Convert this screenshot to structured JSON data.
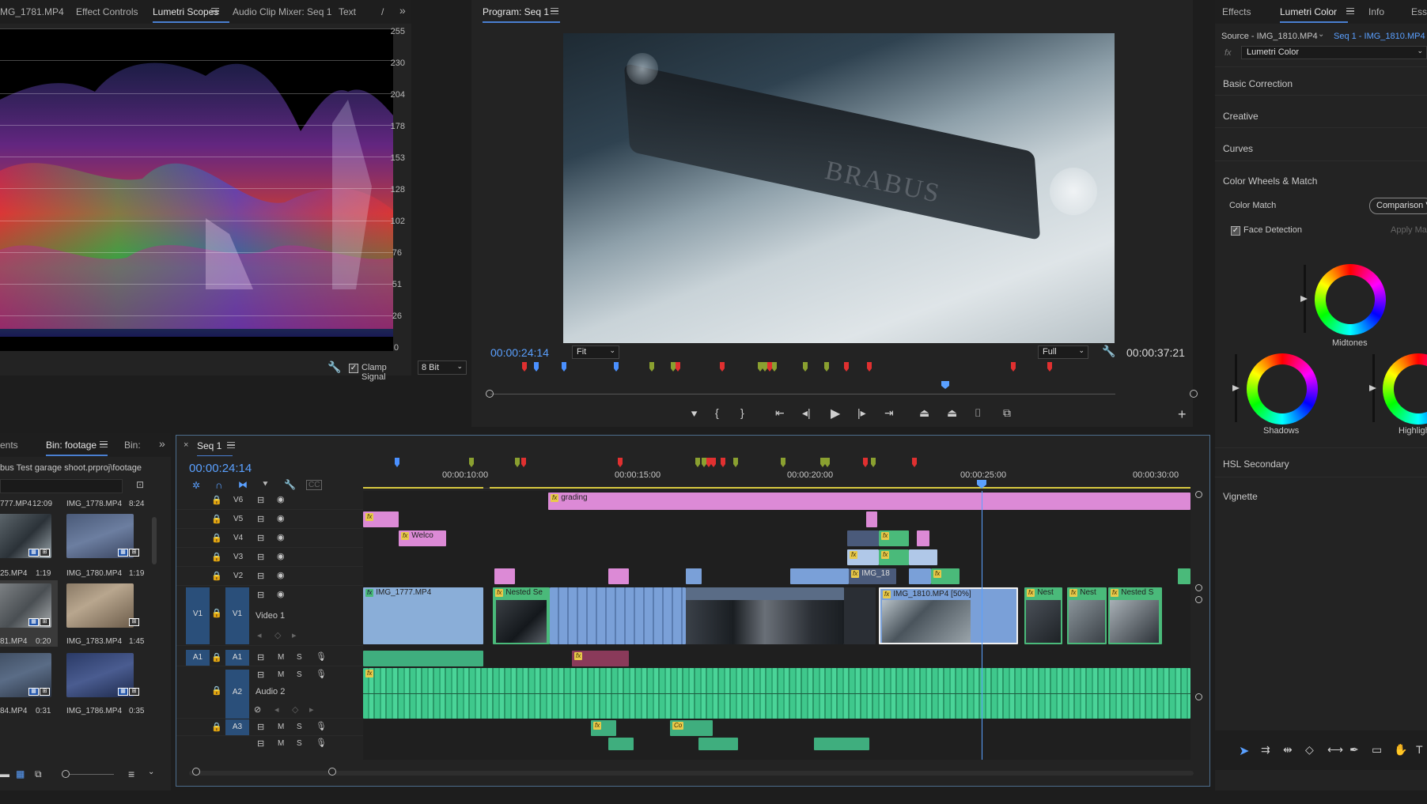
{
  "scopes": {
    "tabs": [
      "MG_1781.MP4",
      "Effect Controls",
      "Lumetri Scopes",
      "Audio Clip Mixer: Seq 1",
      "Text"
    ],
    "scale": [
      "255",
      "230",
      "204",
      "178",
      "153",
      "128",
      "102",
      "76",
      "51",
      "26",
      "0"
    ],
    "clamp_label": "Clamp Signal",
    "bit_depth": "8 Bit"
  },
  "program": {
    "title": "Program: Seq 1",
    "timecode": "00:00:24:14",
    "fit": "Fit",
    "quality": "Full",
    "duration": "00:00:37:21",
    "watermark": "BRABUS"
  },
  "right": {
    "tabs": [
      "Effects",
      "Lumetri Color",
      "Info",
      "Ess"
    ],
    "source": "Source - IMG_1810.MP4",
    "seq": "Seq 1 - IMG_1810.MP4",
    "effect": "Lumetri Color",
    "sections": [
      "Basic Correction",
      "Creative",
      "Curves",
      "Color Wheels & Match"
    ],
    "color_match": "Color Match",
    "comparison": "Comparison V",
    "face_detection": "Face Detection",
    "apply": "Apply Ma",
    "wheels": [
      "Midtones",
      "Shadows",
      "Highligh"
    ],
    "lower_sections": [
      "HSL Secondary",
      "Vignette"
    ]
  },
  "project": {
    "tabs": [
      "ents",
      "Bin: footage",
      "Bin:"
    ],
    "path": "bus Test garage shoot.prproj\\footage",
    "items": [
      {
        "name": "777.MP4",
        "dur": "12:09"
      },
      {
        "name": "IMG_1778.MP4",
        "dur": "8:24"
      },
      {
        "name": "25.MP4",
        "dur": "1:19"
      },
      {
        "name": "IMG_1780.MP4",
        "dur": "1:19"
      },
      {
        "name": "81.MP4",
        "dur": "0:20"
      },
      {
        "name": "IMG_1783.MP4",
        "dur": "1:45"
      },
      {
        "name": "84.MP4",
        "dur": "0:31"
      },
      {
        "name": "IMG_1786.MP4",
        "dur": "0:35"
      }
    ]
  },
  "timeline": {
    "title": "Seq 1",
    "timecode": "00:00:24:14",
    "ruler": [
      "00:00:10:00",
      "00:00:15:00",
      "00:00:20:00",
      "00:00:25:00",
      "00:00:30:00"
    ],
    "video_tracks": [
      "V6",
      "V5",
      "V4",
      "V3",
      "V2",
      "V1"
    ],
    "video1_name": "Video 1",
    "audio_tracks": [
      "A1",
      "A2",
      "A3"
    ],
    "audio2_name": "Audio 2",
    "clips": {
      "grading": "grading",
      "welco": "Welco",
      "img18": "IMG_18",
      "img1777": "IMG_1777.MP4",
      "nested1": "Nested Se",
      "img1810": "IMG_1810.MP4 [50%]",
      "nest_a": "Nest",
      "nest_b": "Nest",
      "nested2": "Nested S"
    }
  }
}
